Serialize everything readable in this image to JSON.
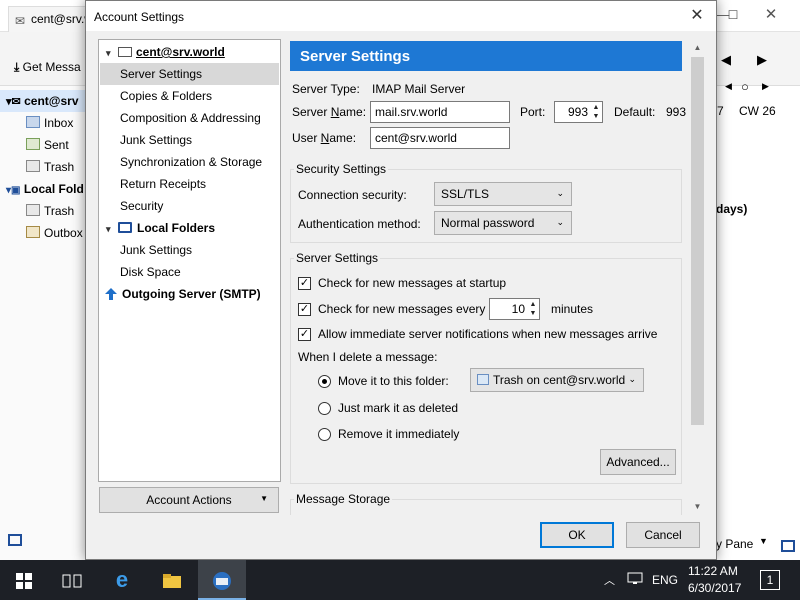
{
  "background_window": {
    "tab_label": "cent@srv.world",
    "get_messages_label": "Get Messa",
    "account_label": "cent@srv",
    "folders": [
      "Inbox",
      "Sent",
      "Trash"
    ],
    "local_folders_label": "Local Fold",
    "local_folders": [
      "Trash",
      "Outbox"
    ],
    "right_texts": {
      "week_num": "7",
      "cw": "CW 26",
      "days": "days)",
      "pane": "y Pane"
    }
  },
  "dialog": {
    "title": "Account Settings",
    "tree": {
      "account": "cent@srv.world",
      "account_items": [
        "Server Settings",
        "Copies & Folders",
        "Composition & Addressing",
        "Junk Settings",
        "Synchronization & Storage",
        "Return Receipts",
        "Security"
      ],
      "local_folders": "Local Folders",
      "local_items": [
        "Junk Settings",
        "Disk Space"
      ],
      "outgoing": "Outgoing Server (SMTP)"
    },
    "account_actions_label": "Account Actions",
    "panel": {
      "header": "Server Settings",
      "server_type_label": "Server Type:",
      "server_type_value": "IMAP Mail Server",
      "server_name_label": "Server Name:",
      "server_name_value": "mail.srv.world",
      "port_label": "Port:",
      "port_value": "993",
      "default_label": "Default:",
      "default_value": "993",
      "user_name_label": "User Name:",
      "user_name_value": "cent@srv.world",
      "security_group_title": "Security Settings",
      "connection_security_label": "Connection security:",
      "connection_security_value": "SSL/TLS",
      "auth_method_label": "Authentication method:",
      "auth_method_value": "Normal password",
      "server_group_title": "Server Settings",
      "check_startup_label": "Check for new messages at startup",
      "check_startup_checked": true,
      "check_every_label": "Check for new messages every",
      "check_every_checked": true,
      "check_every_value": "10",
      "minutes_label": "minutes",
      "allow_notify_label": "Allow immediate server notifications when new messages arrive",
      "allow_notify_checked": true,
      "delete_label": "When I delete a message:",
      "move_label": "Move it to this folder:",
      "move_folder_value": "Trash on cent@srv.world",
      "mark_deleted_label": "Just mark it as deleted",
      "remove_label": "Remove it immediately",
      "selected_delete_option": "move",
      "advanced_label": "Advanced...",
      "message_storage_title": "Message Storage"
    },
    "ok_label": "OK",
    "cancel_label": "Cancel"
  },
  "taskbar": {
    "language": "ENG",
    "time": "11:22 AM",
    "date": "6/30/2017",
    "notification_count": "1"
  },
  "colors": {
    "panel_header": "#1e78d4",
    "taskbar": "#1d2026",
    "default_button_border": "#0078d7"
  }
}
